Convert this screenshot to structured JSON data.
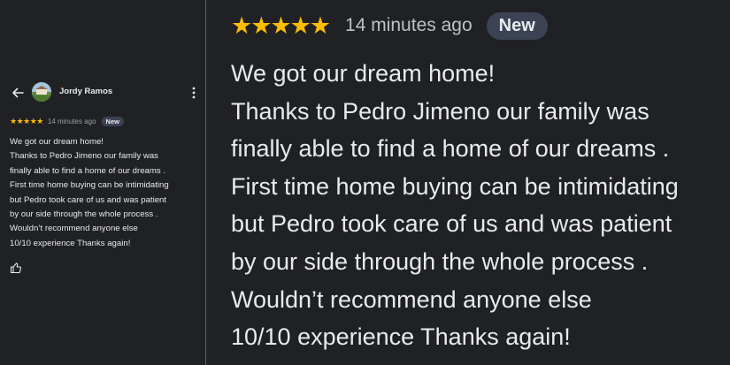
{
  "review": {
    "author": "Jordy Ramos",
    "stars": "★★★★★",
    "rating": 5,
    "time": "14 minutes ago",
    "badge": "New",
    "lines": [
      "We got our dream home!",
      "Thanks to Pedro Jimeno our family was",
      "finally able to find a home of our dreams .",
      "First time home buying can be intimidating",
      "but Pedro took care of us and was patient",
      "by our side through the whole process .",
      "Wouldn’t recommend anyone else",
      "10/10 experience Thanks again!"
    ]
  },
  "icons": {
    "back": "arrow-back-icon",
    "more": "more-vertical-icon",
    "like": "thumbs-up-icon"
  },
  "colors": {
    "background": "#202124",
    "star": "#fbbc04",
    "badge_bg": "#3c4354",
    "text": "#e8eaed",
    "muted": "#9aa0a6"
  }
}
